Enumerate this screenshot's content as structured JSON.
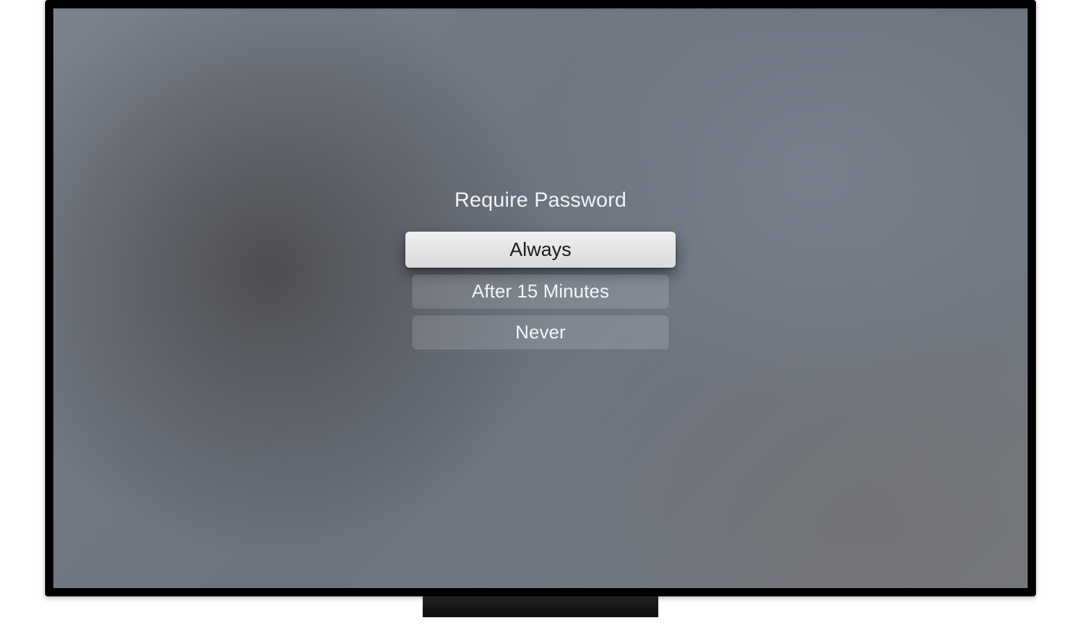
{
  "menu": {
    "title": "Require Password",
    "options": [
      {
        "label": "Always",
        "focused": true
      },
      {
        "label": "After 15 Minutes",
        "focused": false
      },
      {
        "label": "Never",
        "focused": false
      }
    ]
  }
}
